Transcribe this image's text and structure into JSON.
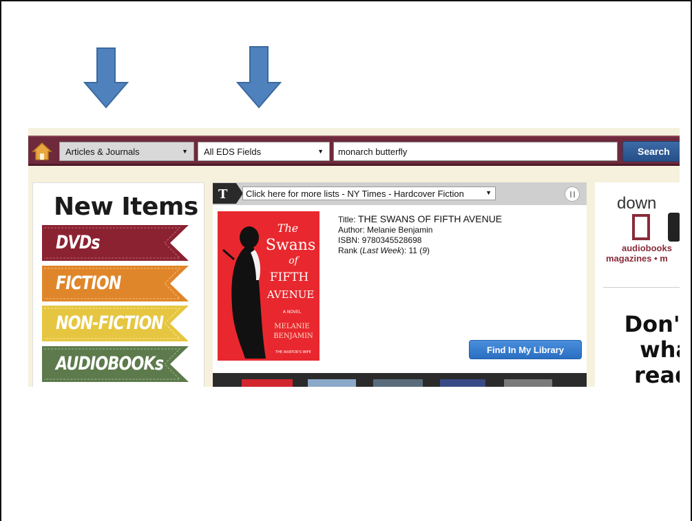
{
  "colors": {
    "arrow": "#4f81bd",
    "searchbar_bg": "#6e2a3c",
    "search_button": "#2a5a96",
    "ribbon_dvds": "#8b2232",
    "ribbon_fiction": "#e0862a",
    "ribbon_nonfiction": "#e6c640",
    "ribbon_audiobooks": "#5c7a4c",
    "find_button": "#3a80d0"
  },
  "icons": {
    "arrow_1": "down-arrow-icon",
    "arrow_2": "down-arrow-icon",
    "home": "home-icon",
    "nyt": "nyt-logo-icon",
    "pause": "pause-icon"
  },
  "search": {
    "scope_label": "Articles & Journals",
    "field_label": "All EDS Fields",
    "query_value": "monarch butterfly",
    "button_label": "Search"
  },
  "new_items": {
    "title": "New Items",
    "categories": [
      {
        "label": "DVDs"
      },
      {
        "label": "FICTION"
      },
      {
        "label": "NON-FICTION"
      },
      {
        "label": "AUDIOBOOKs"
      }
    ]
  },
  "nyt": {
    "list_label": "Click here for more lists - NY Times - Hardcover Fiction",
    "book": {
      "title_prefix": "Title:",
      "title_value": "THE SWANS OF FIFTH AVENUE",
      "author_line": "Author: Melanie Benjamin",
      "isbn_line": "ISBN: 9780345528698",
      "rank_prefix": "Rank (",
      "rank_italic": "Last Week",
      "rank_mid": "): 11 (",
      "rank_last": "9",
      "rank_end": ")"
    },
    "cover": {
      "line1": "The",
      "line2": "Swans",
      "line3": "of",
      "line4": "FIFTH",
      "line5": "AVENUE",
      "subtitle": "A NOVEL",
      "author1": "MELANIE",
      "author2": "BENJAMIN",
      "tagline": "THE AVIATOR'S WIFE"
    },
    "find_button_label": "Find In My Library"
  },
  "right_panel": {
    "download_text": "down",
    "media_line1": "audiobooks",
    "media_line2": "magazines • m",
    "promo_line1": "Don't",
    "promo_line2": "wha",
    "promo_line3": "read"
  }
}
